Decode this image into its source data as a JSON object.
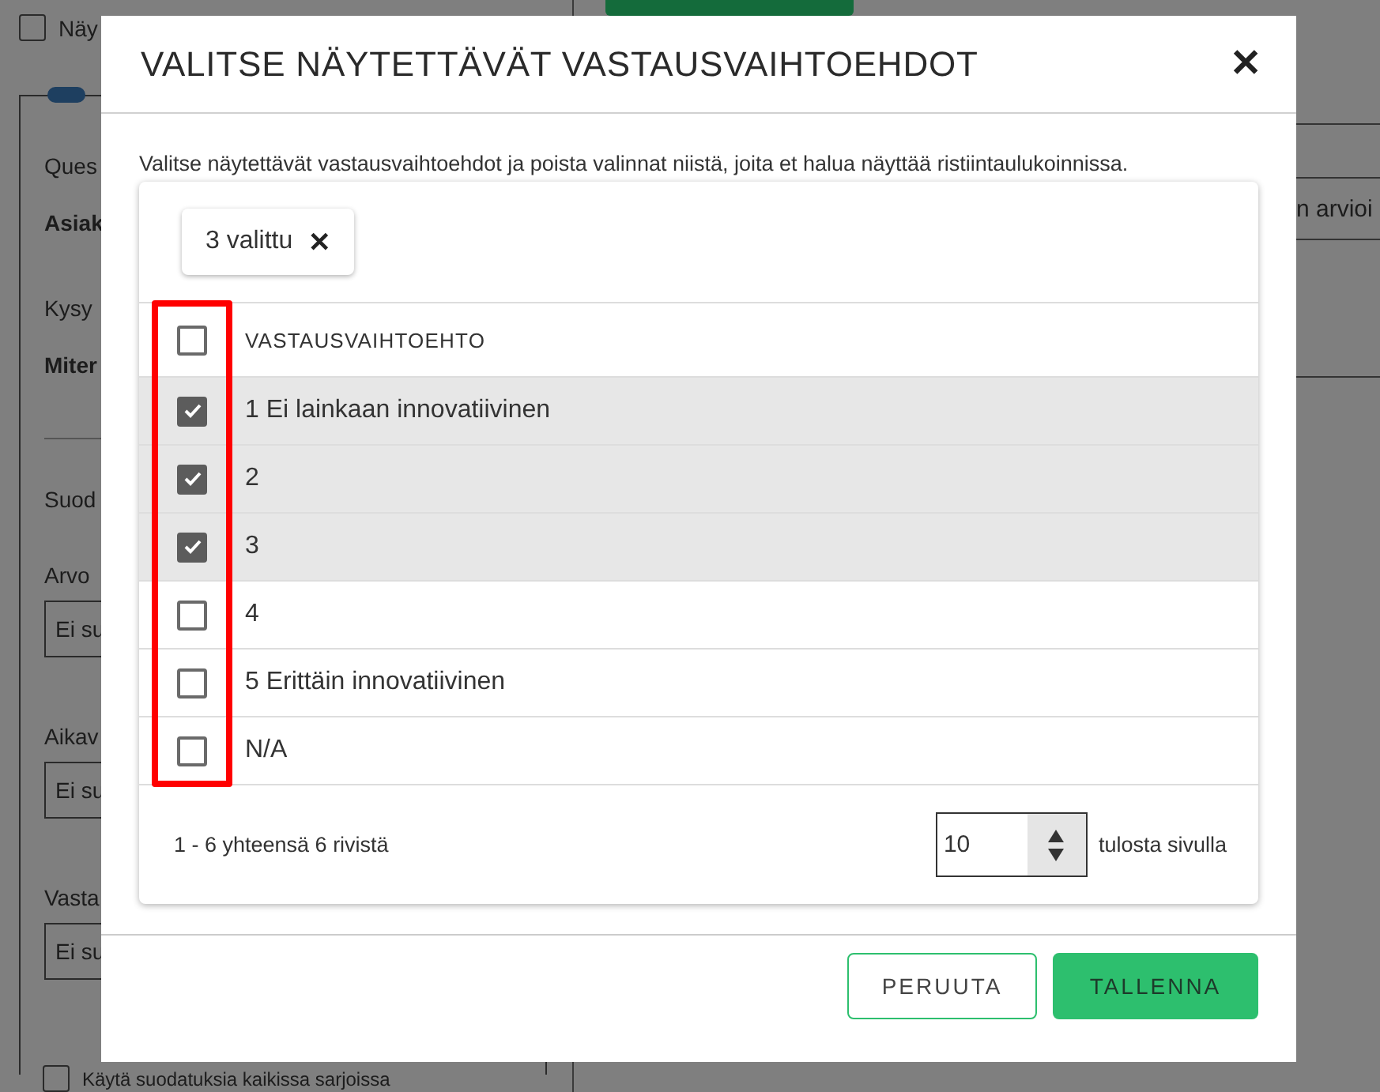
{
  "background": {
    "top_checkbox": {
      "label": "Näy",
      "checked": false
    },
    "toggle": {
      "on": true
    },
    "sections": [
      {
        "kind": "label",
        "text": "Ques"
      },
      {
        "kind": "value",
        "text": "Asiak"
      },
      {
        "kind": "label",
        "text": "Kysy"
      },
      {
        "kind": "value",
        "text": "Miter"
      },
      {
        "kind": "divider"
      },
      {
        "kind": "label",
        "text": "Suod"
      },
      {
        "kind": "label",
        "text": "Arvo"
      },
      {
        "kind": "field",
        "text": "Ei su"
      },
      {
        "kind": "label",
        "text": "Aikav"
      },
      {
        "kind": "field",
        "text": "Ei su"
      },
      {
        "kind": "label",
        "text": "Vasta"
      },
      {
        "kind": "field",
        "text": "Ei su"
      }
    ],
    "bottom_checkbox": {
      "label": "Käytä suodatuksia kaikissa sarjoissa",
      "checked": false
    },
    "right_text": "n arvioi"
  },
  "dialog": {
    "title": "VALITSE NÄYTETTÄVÄT VASTAUSVAIHTOEHDOT",
    "close": "✕",
    "description": "Valitse näytettävät vastausvaihtoehdot ja poista valinnat niistä, joita et halua näyttää ristiintaulukoinnissa.",
    "chip": {
      "label": "3 valittu",
      "clear": "✕"
    },
    "table": {
      "header": {
        "label": "VASTAUSVAIHTOEHTO",
        "checked": false
      },
      "rows": [
        {
          "label": "1 Ei lainkaan innovatiivinen",
          "checked": true
        },
        {
          "label": "2",
          "checked": true
        },
        {
          "label": "3",
          "checked": true
        },
        {
          "label": "4",
          "checked": false
        },
        {
          "label": "5 Erittäin innovatiivinen",
          "checked": false
        },
        {
          "label": "N/A",
          "checked": false
        }
      ]
    },
    "footer": {
      "range": "1 - 6 yhteensä 6 rivistä",
      "page_size": "10",
      "page_size_label": "tulosta sivulla"
    },
    "buttons": [
      {
        "kind": "secondary",
        "label": "PERUUTA"
      },
      {
        "kind": "primary",
        "label": "TALLENNA"
      }
    ]
  }
}
